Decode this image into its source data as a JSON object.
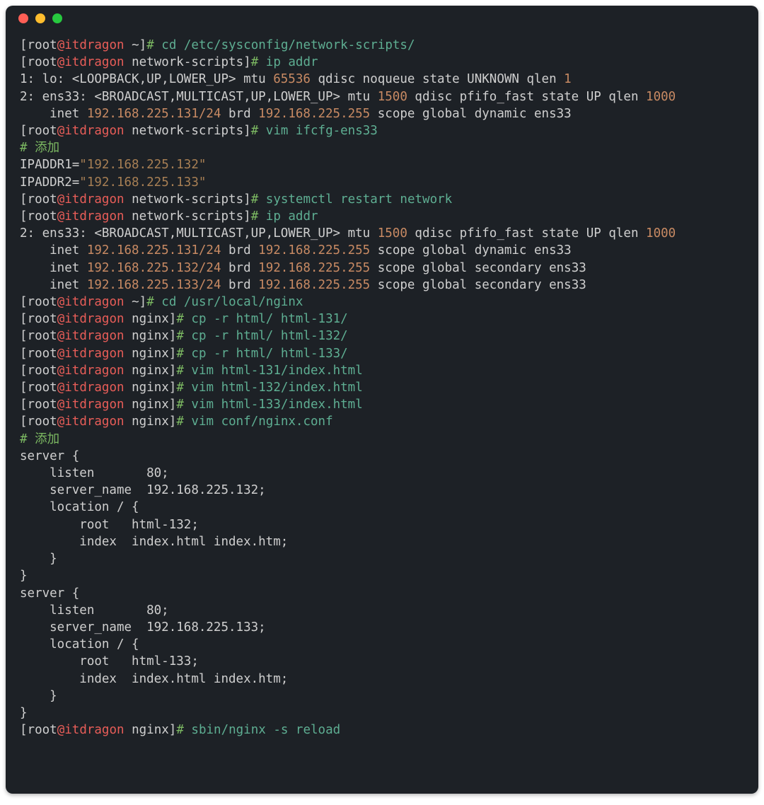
{
  "prompt": {
    "user": "root",
    "at": "@",
    "host": "itdragon",
    "dir_home": "~",
    "dir_net": "network-scripts",
    "dir_ngx": "nginx",
    "bracket_open": "[",
    "bracket_close": "]",
    "hash": "#"
  },
  "cmds": {
    "cd_net": "cd /etc/sysconfig/network-scripts/",
    "ip_addr": "ip addr",
    "vim_ifcfg": "vim ifcfg-ens33",
    "systemctl": "systemctl restart network",
    "cd_nginx": "cd /usr/local/nginx",
    "cp1": "cp -r html/ html-131/",
    "cp2": "cp -r html/ html-132/",
    "cp3": "cp -r html/ html-133/",
    "vim131": "vim html-131/index.html",
    "vim132": "vim html-132/index.html",
    "vim133": "vim html-133/index.html",
    "vimconf": "vim conf/nginx.conf",
    "reload": "sbin/nginx -s reload"
  },
  "out": {
    "lo_a": "1: lo: <LOOPBACK,UP,LOWER_UP> mtu ",
    "lo_mtu": "65536",
    "lo_b": " qdisc noqueue state UNKNOWN qlen ",
    "lo_qlen": "1",
    "ens_a": "2: ens33: <BROADCAST,MULTICAST,UP,LOWER_UP> mtu ",
    "ens_mtu": "1500",
    "ens_b": " qdisc pfifo_fast state UP qlen ",
    "ens_qlen": "1000",
    "inet1_pre": "    inet ",
    "inet1_ip": "192.168.225.131/24",
    "inet1_brd_lbl": " brd ",
    "inet1_brd": "192.168.225.255",
    "inet1_post": " scope global dynamic ens33",
    "inet2_ip": "192.168.225.132/24",
    "inet2_post": " scope global secondary ens33",
    "inet3_ip": "192.168.225.133/24",
    "inet3_post": " scope global secondary ens33"
  },
  "cfg": {
    "comment_add": "# 添加",
    "ipaddr1_key": "IPADDR1=",
    "ipaddr1_val": "\"192.168.225.132\"",
    "ipaddr2_key": "IPADDR2=",
    "ipaddr2_val": "\"192.168.225.133\""
  },
  "nginx_block": "server {\n    listen       80;\n    server_name  192.168.225.132;\n    location / {\n        root   html-132;\n        index  index.html index.htm;\n    }\n}\nserver {\n    listen       80;\n    server_name  192.168.225.133;\n    location / {\n        root   html-133;\n        index  index.html index.htm;\n    }\n}"
}
